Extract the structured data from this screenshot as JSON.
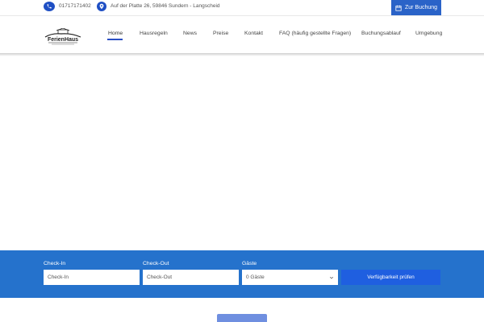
{
  "topbar": {
    "phone": "01717171402",
    "address": "Auf der Platte 26, 59846 Sundern - Langscheid",
    "booking_label": "Zur Buchung",
    "icons": {
      "phone": "phone-icon",
      "address": "map-pin-icon",
      "booking": "calendar-icon"
    }
  },
  "logo": {
    "text": "FerienHaus"
  },
  "nav": {
    "items": [
      {
        "label": "Home"
      },
      {
        "label": "Hausregeln"
      },
      {
        "label": "News"
      },
      {
        "label": "Preise"
      },
      {
        "label": "Kontakt"
      },
      {
        "label": "FAQ (häufig gestellte Fragen)"
      },
      {
        "label": "Buchungsablauf"
      },
      {
        "label": "Umgebung"
      }
    ]
  },
  "booking": {
    "checkin_label": "Check-In",
    "checkin_placeholder": "Check-In",
    "checkout_label": "Check-Out",
    "checkout_placeholder": "Check-Out",
    "guests_label": "Gäste",
    "guests_value": "0 Gäste",
    "submit_label": "Verfügbarkeit prüfen"
  },
  "colors": {
    "accent": "#1f4fc4",
    "booking_bar": "#2572cc",
    "booking_button": "#1f5fe0"
  }
}
